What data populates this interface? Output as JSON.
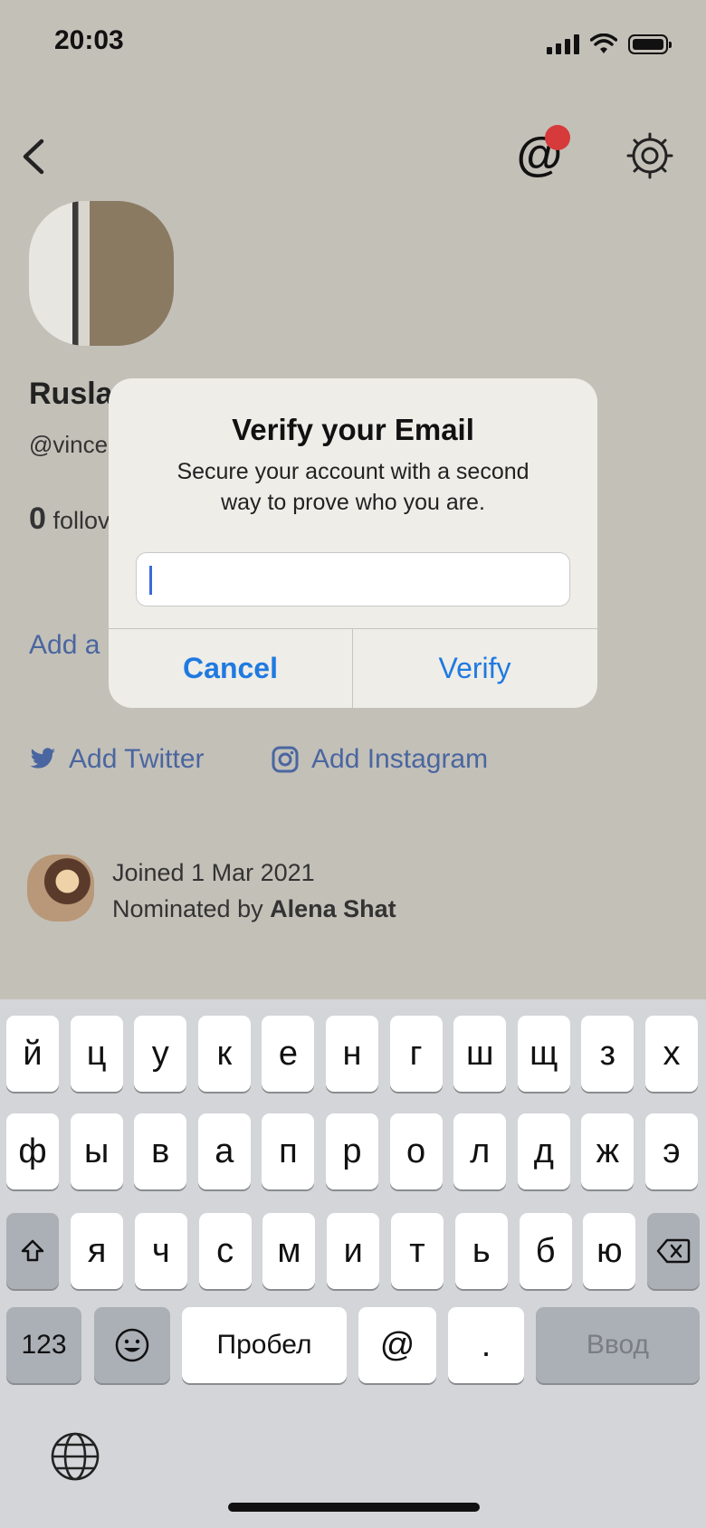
{
  "status_bar": {
    "time": "20:03"
  },
  "profile": {
    "name": "Rusla",
    "handle": "@vince",
    "followers_count": "0",
    "followers_label": "follov",
    "add_link": "Add a",
    "add_twitter": "Add Twitter",
    "add_instagram": "Add Instagram",
    "joined": "Joined 1 Mar 2021",
    "nominated_prefix": "Nominated by",
    "nominated_by": "Alena Shat"
  },
  "dialog": {
    "title": "Verify your Email",
    "message_line1": "Secure your account with a second",
    "message_line2": "way to prove who you are.",
    "input_value": "",
    "cancel_label": "Cancel",
    "verify_label": "Verify"
  },
  "keyboard": {
    "row1": [
      "й",
      "ц",
      "у",
      "к",
      "е",
      "н",
      "г",
      "ш",
      "щ",
      "з",
      "х"
    ],
    "row2": [
      "ф",
      "ы",
      "в",
      "а",
      "п",
      "р",
      "о",
      "л",
      "д",
      "ж",
      "э"
    ],
    "row3": [
      "я",
      "ч",
      "с",
      "м",
      "и",
      "т",
      "ь",
      "б",
      "ю"
    ],
    "numbers_label": "123",
    "space_label": "Пробел",
    "at_label": "@",
    "dot_label": ".",
    "enter_label": "Ввод"
  },
  "colors": {
    "accent_blue": "#1f7ae0",
    "link_blue": "#4a66a0",
    "notification_red": "#d63a3a"
  }
}
